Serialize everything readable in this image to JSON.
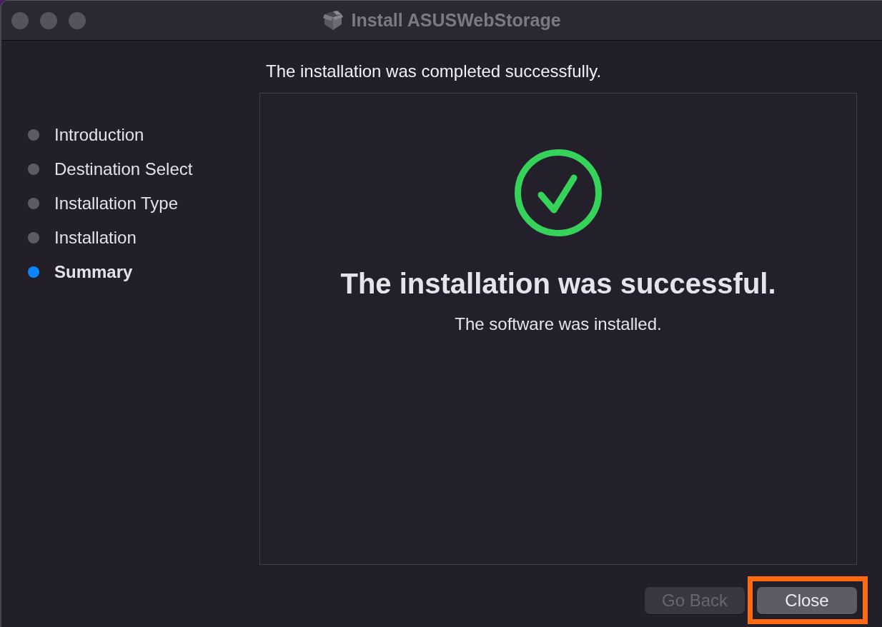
{
  "window": {
    "title": "Install ASUSWebStorage"
  },
  "sidebar": {
    "steps": [
      {
        "label": "Introduction",
        "selected": false
      },
      {
        "label": "Destination Select",
        "selected": false
      },
      {
        "label": "Installation Type",
        "selected": false
      },
      {
        "label": "Installation",
        "selected": false
      },
      {
        "label": "Summary",
        "selected": true
      }
    ]
  },
  "header": "The installation was completed successfully.",
  "result": {
    "kind": "success",
    "title": "The installation was successful.",
    "message": "The software was installed."
  },
  "buttons": [
    {
      "label": "Go Back",
      "disabled": true,
      "highlighted": false
    },
    {
      "label": "Close",
      "disabled": false,
      "highlighted": true
    }
  ]
}
